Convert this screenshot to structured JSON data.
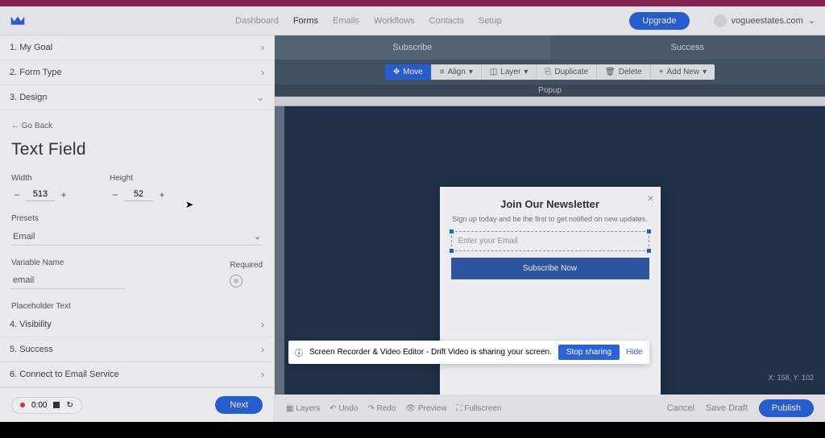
{
  "header": {
    "nav_items": [
      "Dashboard",
      "Forms",
      "Emails",
      "Workflows",
      "Contacts",
      "Setup"
    ],
    "upgrade": "Upgrade",
    "site_name": "vogueestates.com"
  },
  "sidebar": {
    "steps": {
      "goal": "1. My Goal",
      "form_type": "2. Form Type",
      "design": "3. Design",
      "visibility": "4. Visibility",
      "success": "5. Success",
      "connect": "6. Connect to Email Service"
    },
    "go_back": "← Go Back",
    "title": "Text Field",
    "width_label": "Width",
    "width_value": "513",
    "height_label": "Height",
    "height_value": "52",
    "presets_label": "Presets",
    "presets_value": "Email",
    "variable_label": "Variable Name",
    "variable_value": "email",
    "required_label": "Required",
    "placeholder_label": "Placeholder Text",
    "placeholder_value": "Enter your Email",
    "next": "Next",
    "rec_time": "0:00"
  },
  "preview": {
    "tabs": {
      "subscribe": "Subscribe",
      "success": "Success"
    },
    "toolbar": {
      "move": "Move",
      "align": "Align",
      "layer": "Layer",
      "duplicate": "Duplicate",
      "delete": "Delete",
      "add_new": "Add New"
    },
    "popup_label": "Popup",
    "coords": "X: 158, Y: 102",
    "footer_tools": {
      "layers": "Layers",
      "undo": "Undo",
      "redo": "Redo",
      "preview": "Preview",
      "fullscreen": "Fullscreen"
    },
    "newsletter": {
      "title": "Join Our Newsletter",
      "subtitle": "Sign up today and be the first to get notified on new updates.",
      "placeholder": "Enter your Email",
      "button": "Subscribe Now"
    }
  },
  "footer": {
    "cancel": "Cancel",
    "save_draft": "Save Draft",
    "publish": "Publish"
  },
  "notification": {
    "text": "Screen Recorder & Video Editor - Drift Video is sharing your screen.",
    "stop": "Stop sharing",
    "hide": "Hide"
  }
}
